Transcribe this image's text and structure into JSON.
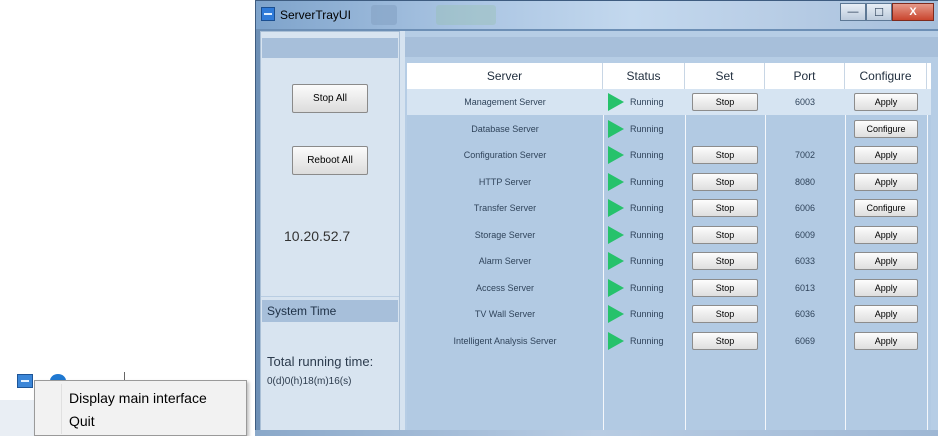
{
  "window": {
    "title": "ServerTrayUI",
    "minimize_label": "—",
    "maximize_label": "☐",
    "close_label": "X"
  },
  "left_panel": {
    "stop_all_label": "Stop All",
    "reboot_all_label": "Reboot All",
    "ip_address": "10.20.52.7",
    "system_time_header": "System Time",
    "running_time_label": "Total running time:",
    "running_time_value": "0(d)0(h)18(m)16(s)"
  },
  "table": {
    "headers": [
      "Server",
      "Status",
      "Set",
      "Port",
      "Configure"
    ],
    "rows": [
      {
        "server": "Management Server",
        "status": "Running",
        "set": "Stop",
        "port": "6003",
        "configure": "Apply",
        "selected": true
      },
      {
        "server": "Database Server",
        "status": "Running",
        "set": "",
        "port": "",
        "configure": "Configure"
      },
      {
        "server": "Configuration Server",
        "status": "Running",
        "set": "Stop",
        "port": "7002",
        "configure": "Apply"
      },
      {
        "server": "HTTP Server",
        "status": "Running",
        "set": "Stop",
        "port": "8080",
        "configure": "Apply"
      },
      {
        "server": "Transfer Server",
        "status": "Running",
        "set": "Stop",
        "port": "6006",
        "configure": "Configure"
      },
      {
        "server": "Storage Server",
        "status": "Running",
        "set": "Stop",
        "port": "6009",
        "configure": "Apply"
      },
      {
        "server": "Alarm Server",
        "status": "Running",
        "set": "Stop",
        "port": "6033",
        "configure": "Apply"
      },
      {
        "server": "Access Server",
        "status": "Running",
        "set": "Stop",
        "port": "6013",
        "configure": "Apply"
      },
      {
        "server": "TV Wall Server",
        "status": "Running",
        "set": "Stop",
        "port": "6036",
        "configure": "Apply"
      },
      {
        "server": "Intelligent Analysis Server",
        "status": "Running",
        "set": "Stop",
        "port": "6069",
        "configure": "Apply"
      }
    ]
  },
  "context_menu": {
    "items": [
      "Display main interface",
      "Quit"
    ]
  },
  "colors": {
    "running": "#26c26b",
    "panel": "#b6cde5",
    "header": "#a7bfda"
  }
}
